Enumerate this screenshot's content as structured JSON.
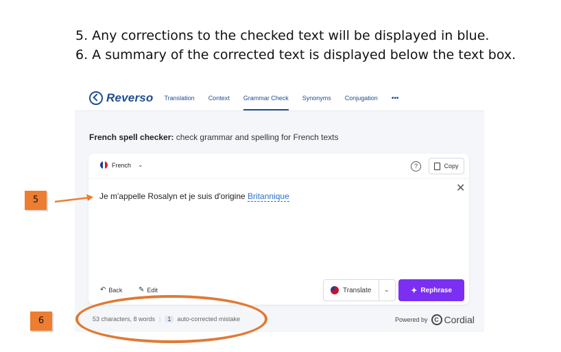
{
  "instructions": {
    "line5": "5. Any corrections to the checked text will be displayed in blue.",
    "line6": "6. A summary of the corrected text is displayed below the text box."
  },
  "nav": {
    "logo": "Reverso",
    "items": [
      "Translation",
      "Context",
      "Grammar Check",
      "Synonyms",
      "Conjugation"
    ],
    "active": "Grammar Check",
    "more": "•••"
  },
  "page": {
    "heading_bold": "French spell checker:",
    "heading_rest": " check grammar and spelling for French texts"
  },
  "card": {
    "language": "French",
    "help": "?",
    "copy_label": "Copy",
    "text_before": "Je m'appelle Rosalyn et je suis d'origine ",
    "text_corrected": "Britannique",
    "back_label": "Back",
    "edit_label": "Edit",
    "translate_label": "Translate",
    "rephrase_label": "Rephrase"
  },
  "summary": {
    "stats": "53 characters, 8 words",
    "count": "1",
    "mistake_label": "auto-corrected mistake",
    "powered_by": "Powered by",
    "brand": "Cordial"
  },
  "callouts": {
    "five": "5",
    "six": "6"
  },
  "colors": {
    "brand": "#1f4d8f",
    "correction": "#2a6ecf",
    "rephrase": "#7b2ff2",
    "callout": "#ed7d31"
  }
}
